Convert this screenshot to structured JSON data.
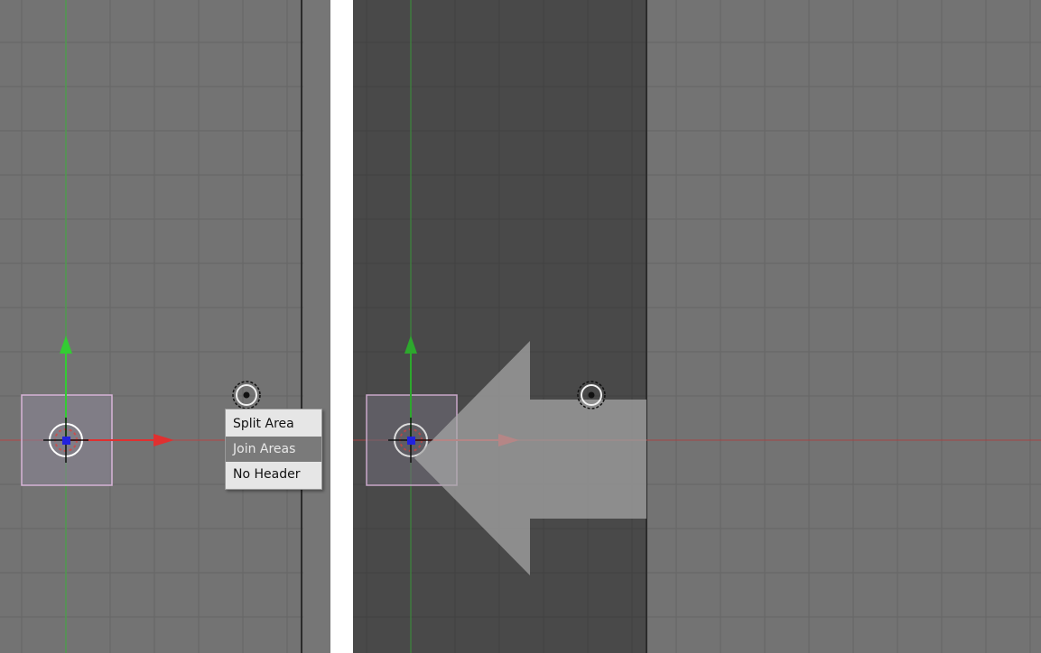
{
  "left_view": {
    "description_role": "3D viewport with area split context menu",
    "context_menu": {
      "items": [
        {
          "label": "Split Area",
          "active": false
        },
        {
          "label": "Join Areas",
          "active": true
        },
        {
          "label": "No Header",
          "active": false
        }
      ]
    }
  },
  "right_view": {
    "description_role": "3D viewport with join-areas direction arrow"
  },
  "colors": {
    "viewport_bg": "#737373",
    "viewport_dark_bg": "#4a4a4a",
    "grid_line": "#666666",
    "x_axis": "#d43a3a",
    "y_axis": "#3fa83f",
    "selection_box": "#c9a7c9",
    "object_origin": "#2222dd",
    "join_arrow": "#9a9a9a",
    "menu_bg": "#e6e6e6",
    "menu_active_bg": "#7a7a7a"
  }
}
